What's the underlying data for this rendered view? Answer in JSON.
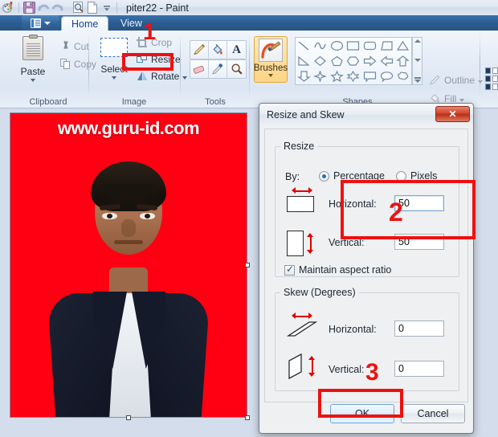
{
  "window": {
    "title": "piter22 - Paint",
    "quick_access": [
      {
        "name": "paint-app-icon",
        "glyph": "palette"
      },
      {
        "name": "save-icon",
        "glyph": "floppy"
      },
      {
        "name": "undo-icon",
        "glyph": "undo-arrow"
      },
      {
        "name": "redo-icon",
        "glyph": "redo-arrow"
      },
      {
        "name": "print-preview-icon",
        "glyph": "page-magnifier"
      },
      {
        "name": "new-file-icon",
        "glyph": "blank-page"
      },
      {
        "name": "customize-quick-access-icon",
        "glyph": "chevron-down"
      }
    ]
  },
  "ribbon": {
    "app_menu_label": "",
    "tabs": [
      {
        "label": "Home",
        "active": true
      },
      {
        "label": "View",
        "active": false
      }
    ],
    "groups": [
      {
        "label": "Clipboard",
        "items": [
          {
            "label": "Paste",
            "icon": "clipboard-icon",
            "enabled": true
          },
          {
            "label": "Cut",
            "icon": "scissors-icon",
            "enabled": false
          },
          {
            "label": "Copy",
            "icon": "copy-icon",
            "enabled": false
          }
        ]
      },
      {
        "label": "Image",
        "items": [
          {
            "label": "Select",
            "icon": "selection-rectangle-icon",
            "enabled": true
          },
          {
            "label": "Crop",
            "icon": "crop-icon",
            "enabled": false
          },
          {
            "label": "Resize",
            "icon": "resize-icon",
            "enabled": true
          },
          {
            "label": "Rotate",
            "icon": "rotate-icon",
            "enabled": true
          }
        ]
      },
      {
        "label": "Tools",
        "items": [
          {
            "icon": "pencil-icon"
          },
          {
            "icon": "fill-with-color-icon"
          },
          {
            "icon": "text-tool-icon"
          },
          {
            "icon": "eraser-icon"
          },
          {
            "icon": "color-picker-icon"
          },
          {
            "icon": "magnifier-icon"
          }
        ]
      },
      {
        "label": "Brushes",
        "items": [
          {
            "label": "Brushes",
            "icon": "brush-icon",
            "selected": true
          }
        ]
      },
      {
        "label": "Shapes",
        "items": [
          {
            "icon": "line-shape-icon"
          },
          {
            "icon": "curve-shape-icon"
          },
          {
            "icon": "oval-shape-icon"
          },
          {
            "icon": "rectangle-shape-icon"
          },
          {
            "icon": "rounded-rectangle-shape-icon"
          },
          {
            "icon": "right-triangle-shape-icon"
          },
          {
            "icon": "triangle-shape-icon"
          },
          {
            "icon": "diagonal-triangle-shape-icon"
          },
          {
            "icon": "diamond-shape-icon"
          },
          {
            "icon": "pentagon-shape-icon"
          },
          {
            "icon": "hexagon-shape-icon"
          },
          {
            "icon": "right-arrow-shape-icon"
          },
          {
            "icon": "left-arrow-shape-icon"
          },
          {
            "icon": "up-arrow-shape-icon"
          },
          {
            "icon": "down-arrow-shape-icon"
          },
          {
            "icon": "four-point-star-shape-icon"
          },
          {
            "icon": "five-point-star-shape-icon"
          },
          {
            "icon": "six-point-star-shape-icon"
          },
          {
            "icon": "rectangular-callout-shape-icon"
          },
          {
            "icon": "rounded-callout-shape-icon"
          },
          {
            "icon": "cloud-callout-shape-icon"
          }
        ],
        "outline_label": "Outline",
        "fill_label": "Fill"
      }
    ]
  },
  "canvas": {
    "watermark_text": "www.guru-id.com",
    "background_color": "#ff0012",
    "subject": "man-in-dark-suit-portrait"
  },
  "dialog": {
    "title": "Resize and Skew",
    "close_label": "✕",
    "resize": {
      "legend": "Resize",
      "by_label": "By:",
      "percentage_label": "Percentage",
      "pixels_label": "Pixels",
      "selected_unit": "Percentage",
      "horizontal_label": "Horizontal:",
      "horizontal_value": "50",
      "vertical_label": "Vertical:",
      "vertical_value": "50",
      "maintain_aspect_ratio_label": "Maintain aspect ratio",
      "maintain_aspect_ratio_checked": true
    },
    "skew": {
      "legend": "Skew (Degrees)",
      "horizontal_label": "Horizontal:",
      "horizontal_value": "0",
      "vertical_label": "Vertical:",
      "vertical_value": "0"
    },
    "ok_label": "OK",
    "cancel_label": "Cancel"
  },
  "annotations": {
    "color": "#ee1111",
    "steps": [
      {
        "number": "1",
        "target": "resize-button"
      },
      {
        "number": "2",
        "target": "resize-percentage-fields"
      },
      {
        "number": "3",
        "target": "ok-button"
      }
    ]
  }
}
